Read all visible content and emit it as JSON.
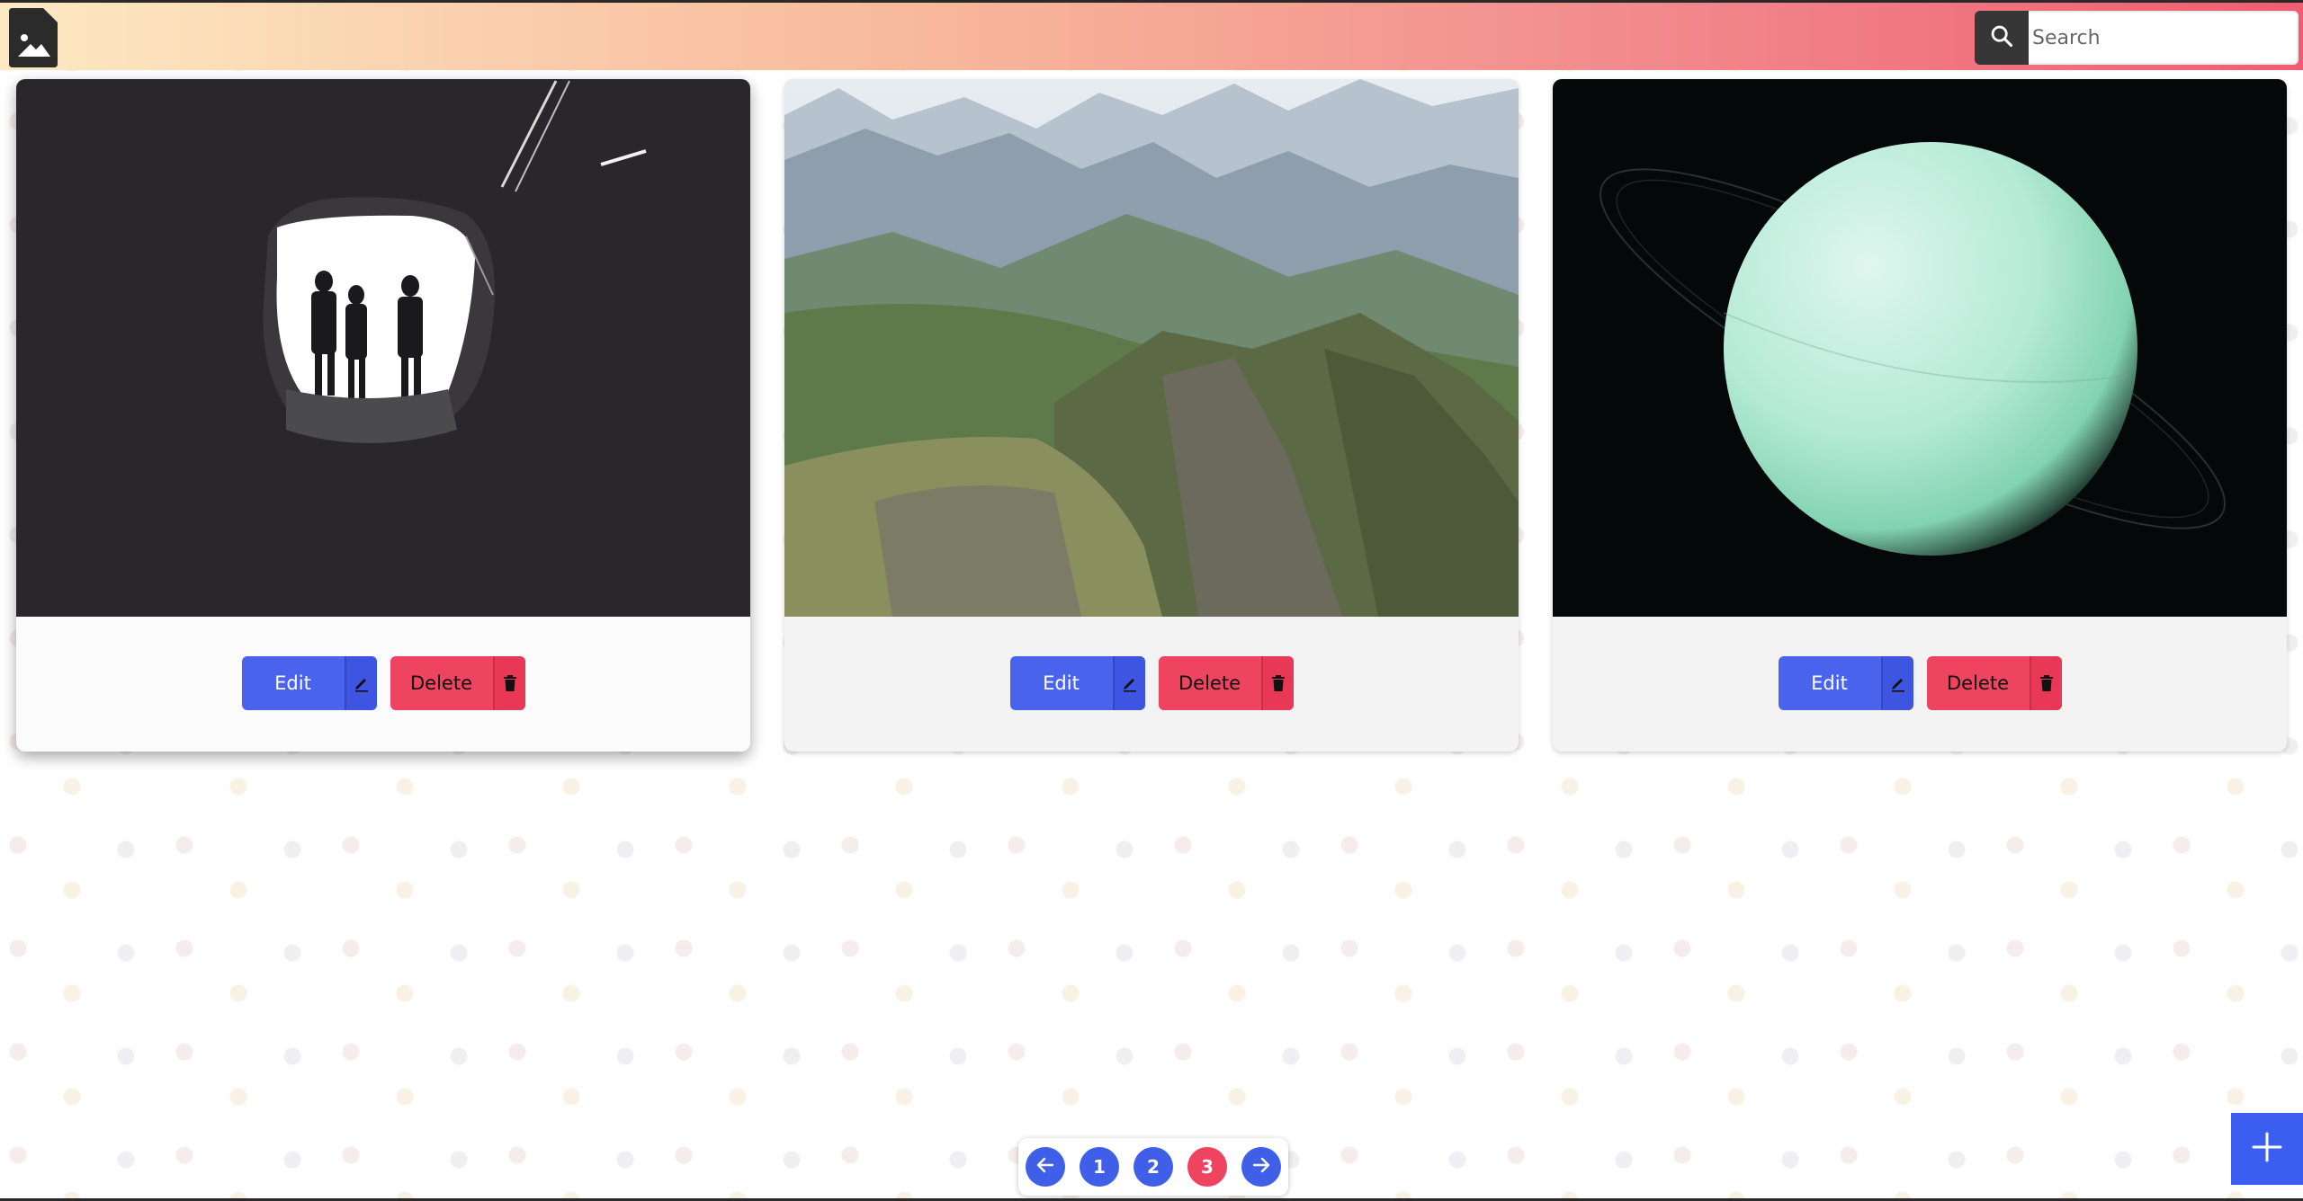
{
  "header": {
    "logo_icon": "image-file-icon",
    "search": {
      "placeholder": "Search",
      "value": "",
      "icon": "search-icon"
    }
  },
  "cards": [
    {
      "image_icon": "cave-silhouette-photo",
      "edit_label": "Edit",
      "edit_icon": "pencil-icon",
      "delete_label": "Delete",
      "delete_icon": "trash-icon"
    },
    {
      "image_icon": "mountain-landscape-photo",
      "edit_label": "Edit",
      "edit_icon": "pencil-icon",
      "delete_label": "Delete",
      "delete_icon": "trash-icon"
    },
    {
      "image_icon": "planet-photo",
      "edit_label": "Edit",
      "edit_icon": "pencil-icon",
      "delete_label": "Delete",
      "delete_icon": "trash-icon"
    }
  ],
  "pagination": {
    "prev_icon": "arrow-left-icon",
    "pages": [
      "1",
      "2",
      "3"
    ],
    "current_page": "3",
    "next_icon": "arrow-right-icon"
  },
  "fab": {
    "icon": "plus-icon"
  },
  "colors": {
    "primary": "#4a63ec",
    "danger": "#ef4460",
    "header_gradient": [
      "#fde9c2",
      "#ef5d72"
    ]
  }
}
